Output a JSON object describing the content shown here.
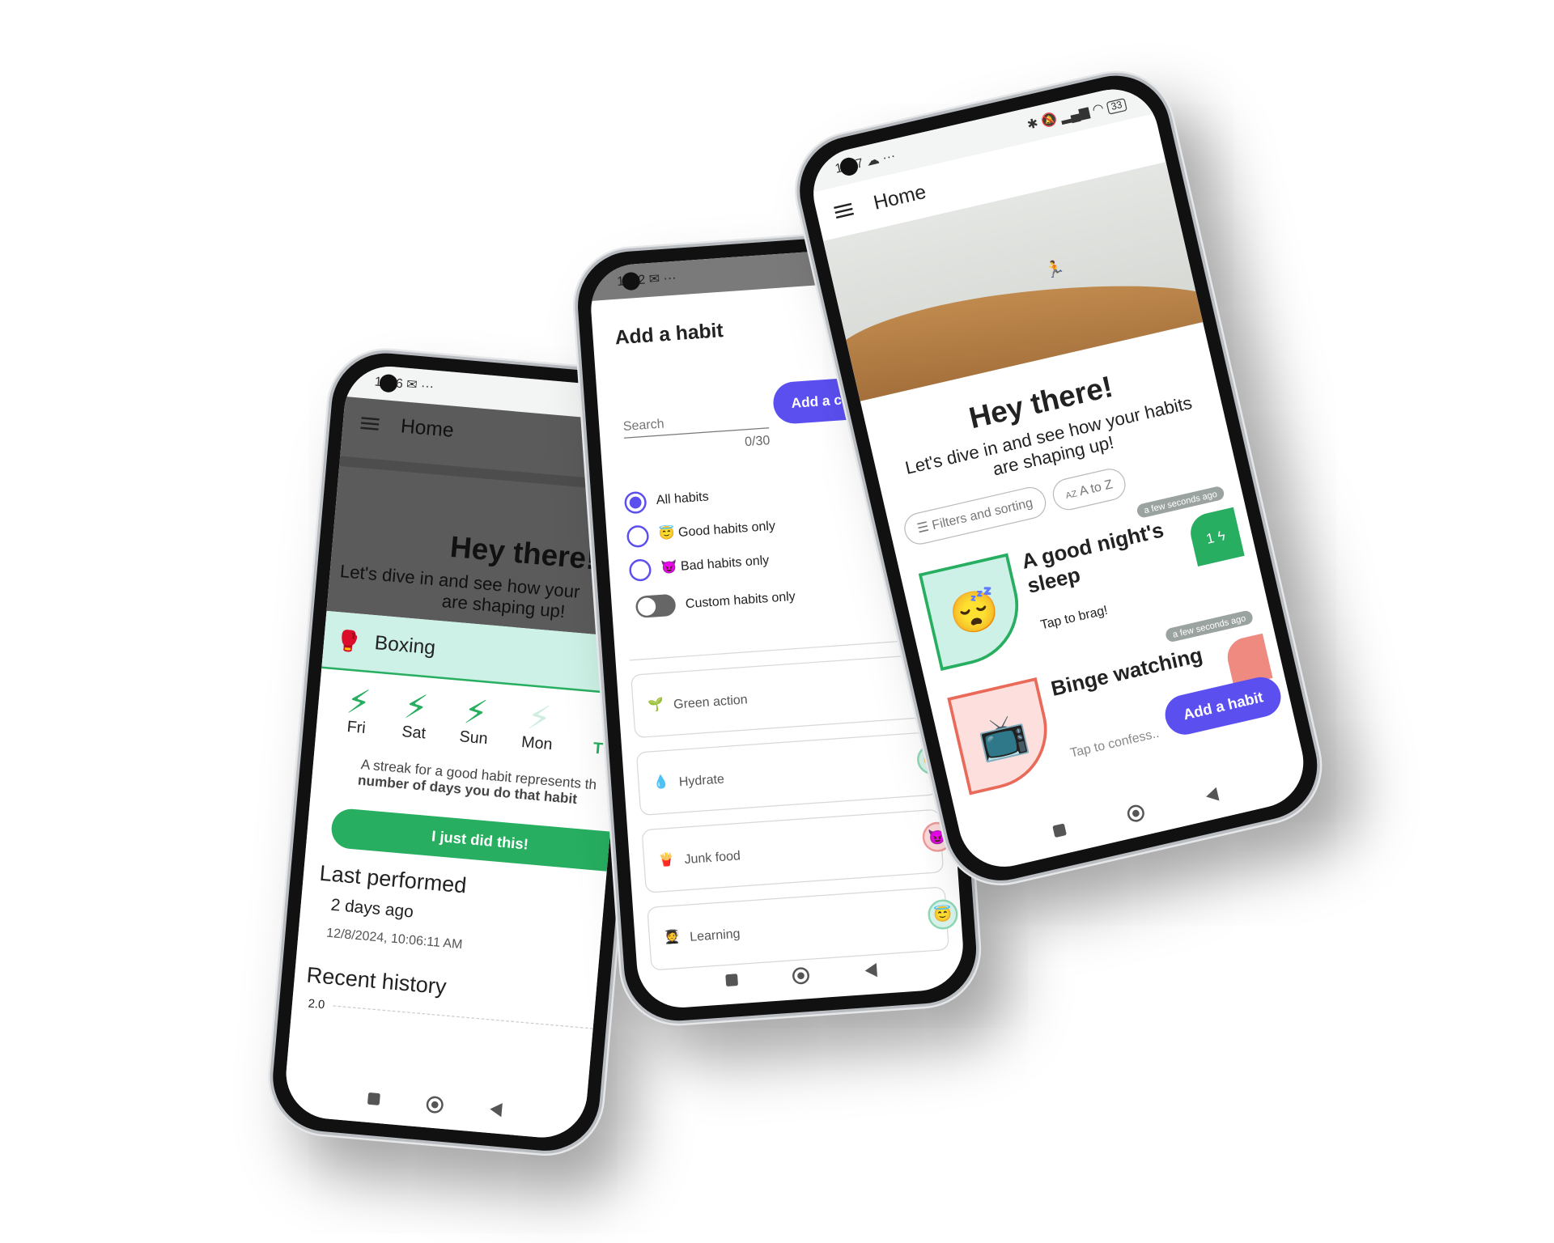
{
  "left_phone": {
    "status": {
      "time_start": "1",
      "time_end": "6",
      "icons": [
        "gmail-icon",
        "more-icon",
        "bluetooth-icon",
        "mute-icon"
      ]
    },
    "appbar_title": "Home",
    "hero": {
      "title": "Hey there!",
      "subtitle_line1": "Let's dive in and see how your",
      "subtitle_line2": "are shaping up!"
    },
    "sheet": {
      "habit_name": "Boxing",
      "habit_emoji": "🥊",
      "days": [
        {
          "label": "Fri",
          "done": true
        },
        {
          "label": "Sat",
          "done": true
        },
        {
          "label": "Sun",
          "done": true
        },
        {
          "label": "Mon",
          "done": false
        },
        {
          "label": "T",
          "done": true
        }
      ],
      "streak_text": "A streak for a good habit represents th",
      "streak_bold": "number of days you do that habit",
      "action_button": "I just did this!",
      "last_performed_heading": "Last performed",
      "last_performed_relative": "2 days ago",
      "last_performed_date": "12/8/2024, 10:06:11 AM",
      "recent_history_heading": "Recent history",
      "chart_y_tick": "2.0"
    }
  },
  "middle_phone": {
    "status": {
      "time_start": "1",
      "time_end": "2",
      "icons": [
        "gmail-icon",
        "more-icon",
        "bluetooth-icon",
        "mute-icon"
      ]
    },
    "dialog_title": "Add a habit",
    "search": {
      "placeholder": "Search",
      "value": "",
      "counter": "0/30"
    },
    "add_custom_button": "Add a custo",
    "filters": [
      {
        "label": "All habits",
        "emoji": "",
        "selected": true
      },
      {
        "label": "Good habits only",
        "emoji": "😇",
        "selected": false
      },
      {
        "label": "Bad habits only",
        "emoji": "😈",
        "selected": false
      }
    ],
    "custom_toggle": {
      "label": "Custom habits only",
      "on": false
    },
    "habits": [
      {
        "name": "Green action",
        "emoji": "🌱",
        "type": "good",
        "badge": "😇"
      },
      {
        "name": "Hydrate",
        "emoji": "💧",
        "type": "good",
        "badge": "😇"
      },
      {
        "name": "Junk food",
        "emoji": "🍟",
        "type": "bad",
        "badge": "😈"
      },
      {
        "name": "Learning",
        "emoji": "🧑‍🎓",
        "type": "good",
        "badge": "😇"
      }
    ]
  },
  "right_phone": {
    "status": {
      "time_start": "1",
      "time_end": "7",
      "battery": "33",
      "icons": [
        "cloud-icon",
        "more-icon",
        "bluetooth-icon",
        "mute-icon",
        "signal-icon",
        "wifi-icon",
        "battery-icon"
      ]
    },
    "appbar_title": "Home",
    "hero": {
      "title": "Hey there!",
      "subtitle": "Let's dive in and see how your habits are shaping up!"
    },
    "chips": {
      "filters": "Filters and sorting",
      "sort": "A to Z"
    },
    "habits": [
      {
        "name": "A good night's sleep",
        "emoji": "😴",
        "hint": "Tap to brag!",
        "updated": "a few seconds ago",
        "streak": "1",
        "type": "good"
      },
      {
        "name": "Binge watching",
        "emoji": "📺",
        "hint": "Tap to confess..",
        "updated": "a few seconds ago",
        "streak": "",
        "type": "bad"
      }
    ],
    "fab": "Add a habit"
  },
  "colors": {
    "accent": "#5b4ff0",
    "good": "#27ae60",
    "good_bg": "#cdf1e6",
    "bad": "#ea6a5a",
    "bad_bg": "#fde0de",
    "scrim": "#5b5b5b"
  }
}
